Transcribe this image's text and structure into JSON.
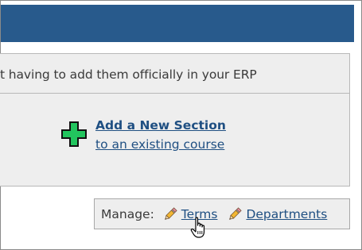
{
  "notice": {
    "text": "t having to add them officially in your ERP"
  },
  "add_section": {
    "title": "Add a New Section",
    "subtitle": "to an existing course",
    "icon": "green-plus-icon"
  },
  "manage": {
    "label": "Manage:",
    "links": [
      {
        "label": "Terms",
        "icon": "pencil-icon"
      },
      {
        "label": "Departments",
        "icon": "pencil-icon"
      }
    ]
  },
  "colors": {
    "header": "#285a8c",
    "panel": "#eeeeee",
    "link": "#1f4f82",
    "plus": "#22c55e"
  }
}
